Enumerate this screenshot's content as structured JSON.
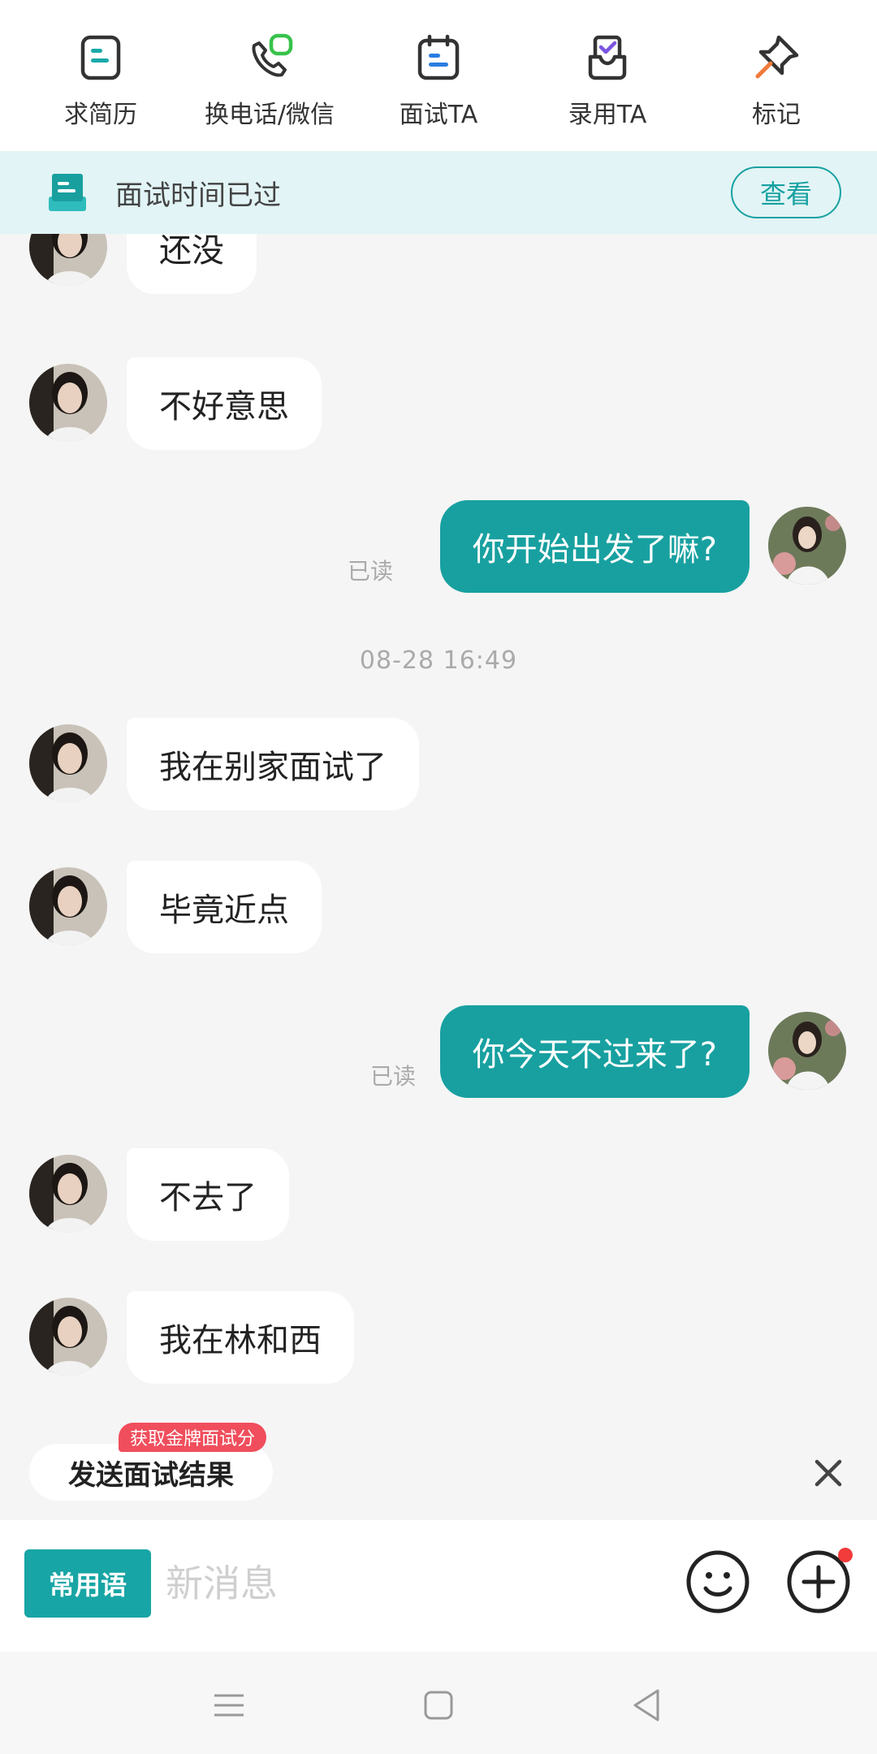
{
  "toolbar": {
    "items": [
      {
        "label": "求简历",
        "icon": "resume-icon"
      },
      {
        "label": "换电话/微信",
        "icon": "phone-wechat-icon"
      },
      {
        "label": "面试TA",
        "icon": "interview-calendar-icon"
      },
      {
        "label": "录用TA",
        "icon": "hire-check-icon"
      },
      {
        "label": "标记",
        "icon": "pin-icon"
      }
    ]
  },
  "notice": {
    "icon": "document-stack-icon",
    "text": "面试时间已过",
    "button_label": "查看"
  },
  "chat": {
    "messages": [
      {
        "side": "in",
        "text": "还没"
      },
      {
        "side": "in",
        "text": "不好意思"
      },
      {
        "side": "out",
        "text": "你开始出发了嘛?",
        "status": "已读"
      },
      {
        "side": "in",
        "text": "我在别家面试了"
      },
      {
        "side": "in",
        "text": "毕竟近点"
      },
      {
        "side": "out",
        "text": "你今天不过来了?",
        "status": "已读"
      },
      {
        "side": "in",
        "text": "不去了"
      },
      {
        "side": "in",
        "text": "我在林和西"
      }
    ],
    "timestamp": "08-28 16:49"
  },
  "interview_result": {
    "badge": "获取金牌面试分",
    "label": "发送面试结果",
    "close_icon": "close-icon"
  },
  "input_bar": {
    "phrases_label": "常用语",
    "placeholder": "新消息",
    "emoji_icon": "emoji-icon",
    "plus_icon": "plus-icon",
    "plus_has_notification": true
  },
  "colors": {
    "accent": "#18a0a0",
    "notice_bg": "#e2f4f5",
    "badge_red": "#f04e5c",
    "chat_bg": "#f5f5f5"
  }
}
